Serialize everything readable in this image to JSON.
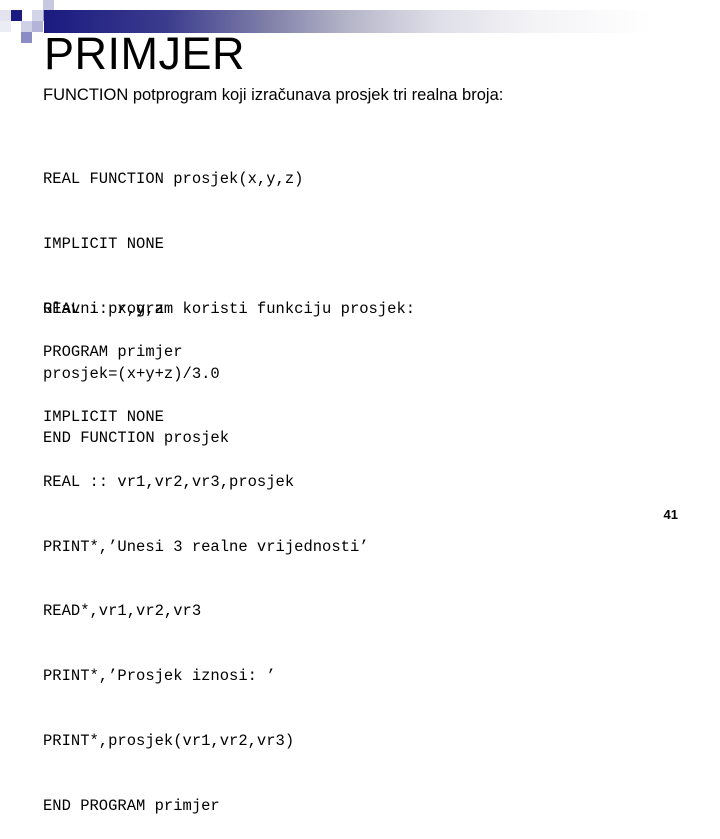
{
  "slide": {
    "title": "PRIMJER",
    "subtitle": "FUNCTION potprogram koji izračunava prosjek tri realna broja:",
    "function_code": [
      "REAL FUNCTION prosjek(x,y,z)",
      "IMPLICIT NONE",
      "REAL :: x,y,z",
      "prosjek=(x+y+z)/3.0",
      "END FUNCTION prosjek"
    ],
    "note": "Glavni program koristi funkciju prosjek:",
    "program_code": [
      "PROGRAM primjer",
      "IMPLICIT NONE",
      "REAL :: vr1,vr2,vr3,prosjek",
      "PRINT*,’Unesi 3 realne vrijednosti’",
      "READ*,vr1,vr2,vr3",
      "PRINT*,’Prosjek iznosi: ’",
      "PRINT*,prosjek(vr1,vr2,vr3)",
      "END PROGRAM primjer"
    ],
    "page_number": "41"
  },
  "theme": {
    "accent": "#1a1a80",
    "logo_colors": [
      "#1a1a80",
      "#d8d8ea",
      "#a6a6cf",
      "#7d7dbb",
      "#c8c8e0"
    ]
  }
}
